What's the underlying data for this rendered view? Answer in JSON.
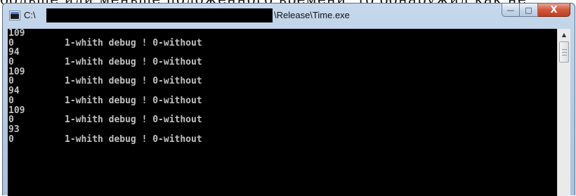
{
  "document": {
    "cropped_text": "больше или меньше положенного времени, то обнаружил как не"
  },
  "window": {
    "title_prefix": "C:\\",
    "title_suffix": "\\Release\\Time.exe",
    "buttons": {
      "minimize": "—",
      "maximize": "□",
      "close": "X"
    }
  },
  "console": {
    "lines": [
      {
        "num": "109",
        "text": ""
      },
      {
        "num": "0",
        "text": "1-whith debug ! 0-without"
      },
      {
        "num": "94",
        "text": ""
      },
      {
        "num": "0",
        "text": "1-whith debug ! 0-without"
      },
      {
        "num": "109",
        "text": ""
      },
      {
        "num": "0",
        "text": "1-whith debug ! 0-without"
      },
      {
        "num": "94",
        "text": ""
      },
      {
        "num": "0",
        "text": "1-whith debug ! 0-without"
      },
      {
        "num": "109",
        "text": ""
      },
      {
        "num": "0",
        "text": "1-whith debug ! 0-without"
      },
      {
        "num": "93",
        "text": ""
      },
      {
        "num": "0",
        "text": "1-whith debug ! 0-without"
      }
    ]
  },
  "scrollbar": {
    "up_arrow": "▲"
  }
}
